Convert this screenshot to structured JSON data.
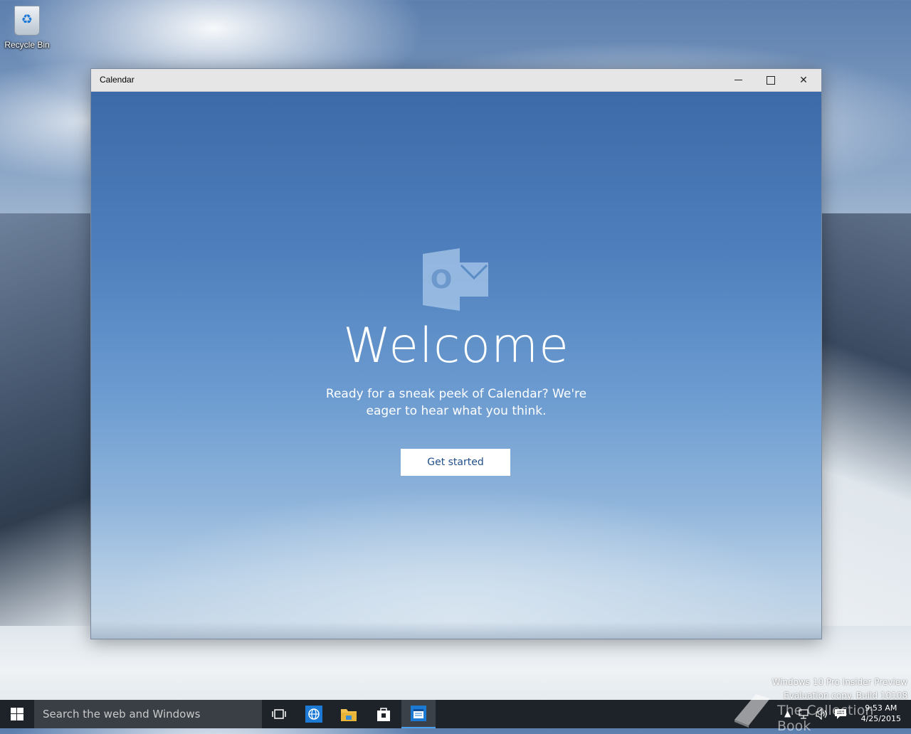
{
  "desktop": {
    "recycle_bin_label": "Recycle Bin",
    "watermark_line1": "Windows 10 Pro Insider Preview",
    "watermark_line2": "Evaluation copy. Build 10108",
    "overlay_text": "The Collection Book"
  },
  "window": {
    "title": "Calendar",
    "minimize_icon": "minimize-icon",
    "maximize_icon": "maximize-icon",
    "close_glyph": "✕"
  },
  "welcome": {
    "logo_letter": "O",
    "heading": "Welcome",
    "subtitle": "Ready for a sneak peek of Calendar? We're eager to hear what you think.",
    "button_label": "Get started"
  },
  "taskbar": {
    "search_placeholder": "Search the web and Windows",
    "apps": [
      "task-view",
      "internet-explorer",
      "file-explorer",
      "store",
      "calendar"
    ],
    "active_app": "calendar",
    "tray_up": "▲",
    "time": "9:53 AM",
    "date": "4/25/2015"
  },
  "colors": {
    "accent": "#4aa0ea",
    "taskbar": "#1e2329",
    "button_text": "#1f4e8c"
  }
}
